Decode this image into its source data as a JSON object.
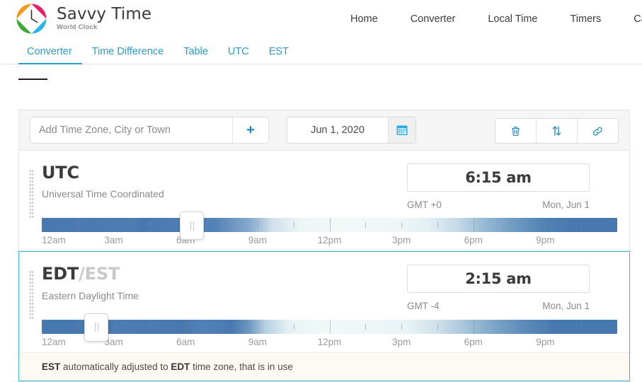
{
  "brand": {
    "title": "Savvy Time",
    "subtitle": "World Clock",
    "logo_icon": "clock-logo-icon"
  },
  "topnav": {
    "items": [
      {
        "label": "Home"
      },
      {
        "label": "Converter"
      },
      {
        "label": "Local Time"
      },
      {
        "label": "Timers"
      },
      {
        "label": "Calendar"
      }
    ]
  },
  "tabs": [
    {
      "label": "Converter",
      "active": true
    },
    {
      "label": "Time Difference",
      "active": false
    },
    {
      "label": "Table",
      "active": false
    },
    {
      "label": "UTC",
      "active": false
    },
    {
      "label": "EST",
      "active": false
    }
  ],
  "toolbar": {
    "search_placeholder": "Add Time Zone, City or Town",
    "search_value": "",
    "add_icon": "plus-icon",
    "date_value": "Jun 1, 2020",
    "calendar_icon": "calendar-icon",
    "buttons": [
      {
        "name": "delete-all-button",
        "icon": "trash-icon"
      },
      {
        "name": "sort-button",
        "icon": "sort-updown-icon"
      },
      {
        "name": "share-link-button",
        "icon": "link-icon"
      }
    ]
  },
  "zones": [
    {
      "abbr": "UTC",
      "abbr_alt": "",
      "name": "Universal Time Coordinated",
      "time": "6:15 am",
      "gmt": "GMT +0",
      "date": "Mon, Jun 1",
      "slider_percent": 26.0,
      "selected": false,
      "ticks": [
        "12am",
        "3am",
        "6am",
        "9am",
        "12pm",
        "3pm",
        "6pm",
        "9pm"
      ]
    },
    {
      "abbr": "EDT",
      "abbr_alt": "/EST",
      "name": "Eastern Daylight Time",
      "time": "2:15 am",
      "gmt": "GMT -4",
      "date": "Mon, Jun 1",
      "slider_percent": 9.4,
      "selected": true,
      "ticks": [
        "12am",
        "3am",
        "6am",
        "9am",
        "12pm",
        "3pm",
        "6pm",
        "9pm"
      ]
    }
  ],
  "notice": {
    "part1": "EST",
    "part2": " automatically adjusted to ",
    "part3": "EDT",
    "part4": " time zone, that is in use"
  },
  "colors": {
    "accent": "#2d9cc8",
    "selected_border": "#37b6d3",
    "icon_blue": "#2389c4",
    "night": "#4878b0",
    "day": "#f0f8f8",
    "notice_bg": "#fcfaf2"
  }
}
